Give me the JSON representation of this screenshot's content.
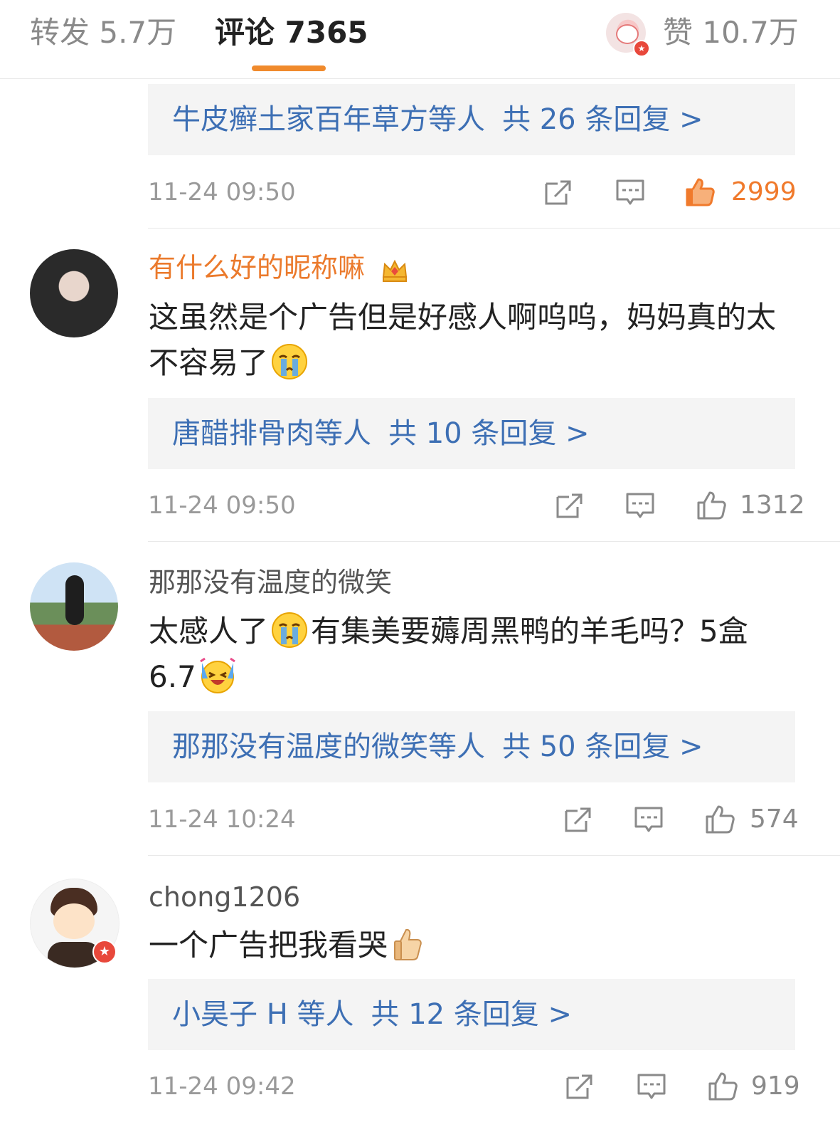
{
  "tabs": {
    "forward": "转发 5.7万",
    "comments": "评论 7365",
    "likes": "赞 10.7万"
  },
  "comments": [
    {
      "replies_summary": "牛皮癣土家百年草方等人",
      "replies_count": "共 26 条回复 >",
      "time": "11-24 09:50",
      "likes": "2999",
      "liked": true
    },
    {
      "username": "有什么好的昵称嘛",
      "text": "这虽然是个广告但是好感人啊呜呜，妈妈真的太不容易了",
      "emoji": "crying-emoji",
      "replies_summary": "唐醋排骨肉等人",
      "replies_count": "共 10 条回复 >",
      "time": "11-24 09:50",
      "likes": "1312"
    },
    {
      "username": "那那没有温度的微笑",
      "text_before": "太感人了",
      "text_after": "有集美要薅周黑鸭的羊毛吗？5盒 6.7",
      "emoji1": "crying-emoji",
      "emoji2": "laugh-cry-emoji",
      "replies_summary": "那那没有温度的微笑等人",
      "replies_count": "共 50 条回复 >",
      "time": "11-24 10:24",
      "likes": "574"
    },
    {
      "username": "chong1206",
      "text": "一个广告把我看哭",
      "emoji": "thumbs-up-emoji",
      "replies_summary": "小昊子 H 等人",
      "replies_count": "共 12 条回复 >",
      "time": "11-24 09:42",
      "likes": "919"
    }
  ],
  "colors": {
    "accent": "#f08a2c",
    "link": "#3d6fb4",
    "vip_name": "#eb7a2c",
    "muted": "#9a9a9a"
  }
}
